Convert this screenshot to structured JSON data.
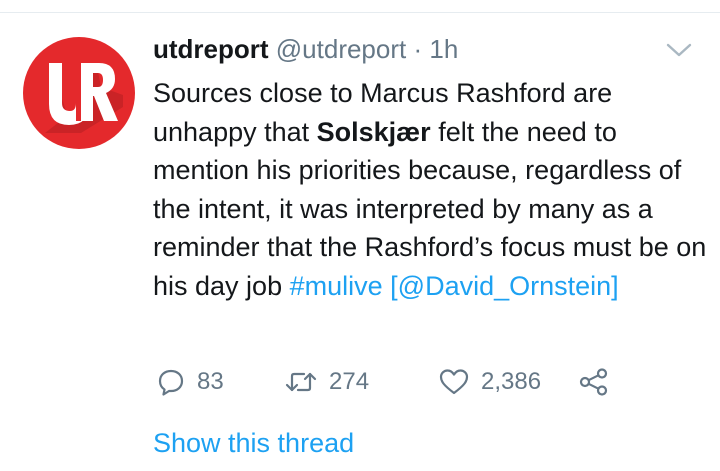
{
  "tweet": {
    "display_name": "utdreport",
    "handle": "@utdreport",
    "separator": "·",
    "time": "1h",
    "avatar_letters": "UR",
    "text_parts": {
      "p1": "Sources close to Marcus Rashford are unhappy that ",
      "bold": "Solskjær",
      "p2": " felt the need to mention his priorities because, regardless of the intent, it was interpreted by many as a reminder that the Rashford’s focus must be on his day job ",
      "hashtag": "#mulive",
      "p3": " [",
      "mention": "@David_Ornstein",
      "p4": "]"
    },
    "replies": "83",
    "retweets": "274",
    "likes": "2,386",
    "show_thread": "Show this thread"
  },
  "icons": [
    "chevron-down-icon",
    "reply-icon",
    "retweet-icon",
    "heart-icon",
    "share-icon"
  ],
  "colors": {
    "link": "#1da1f2",
    "secondary_text": "#657786",
    "avatar_red": "#e4292c",
    "primary_text": "#14171a"
  }
}
